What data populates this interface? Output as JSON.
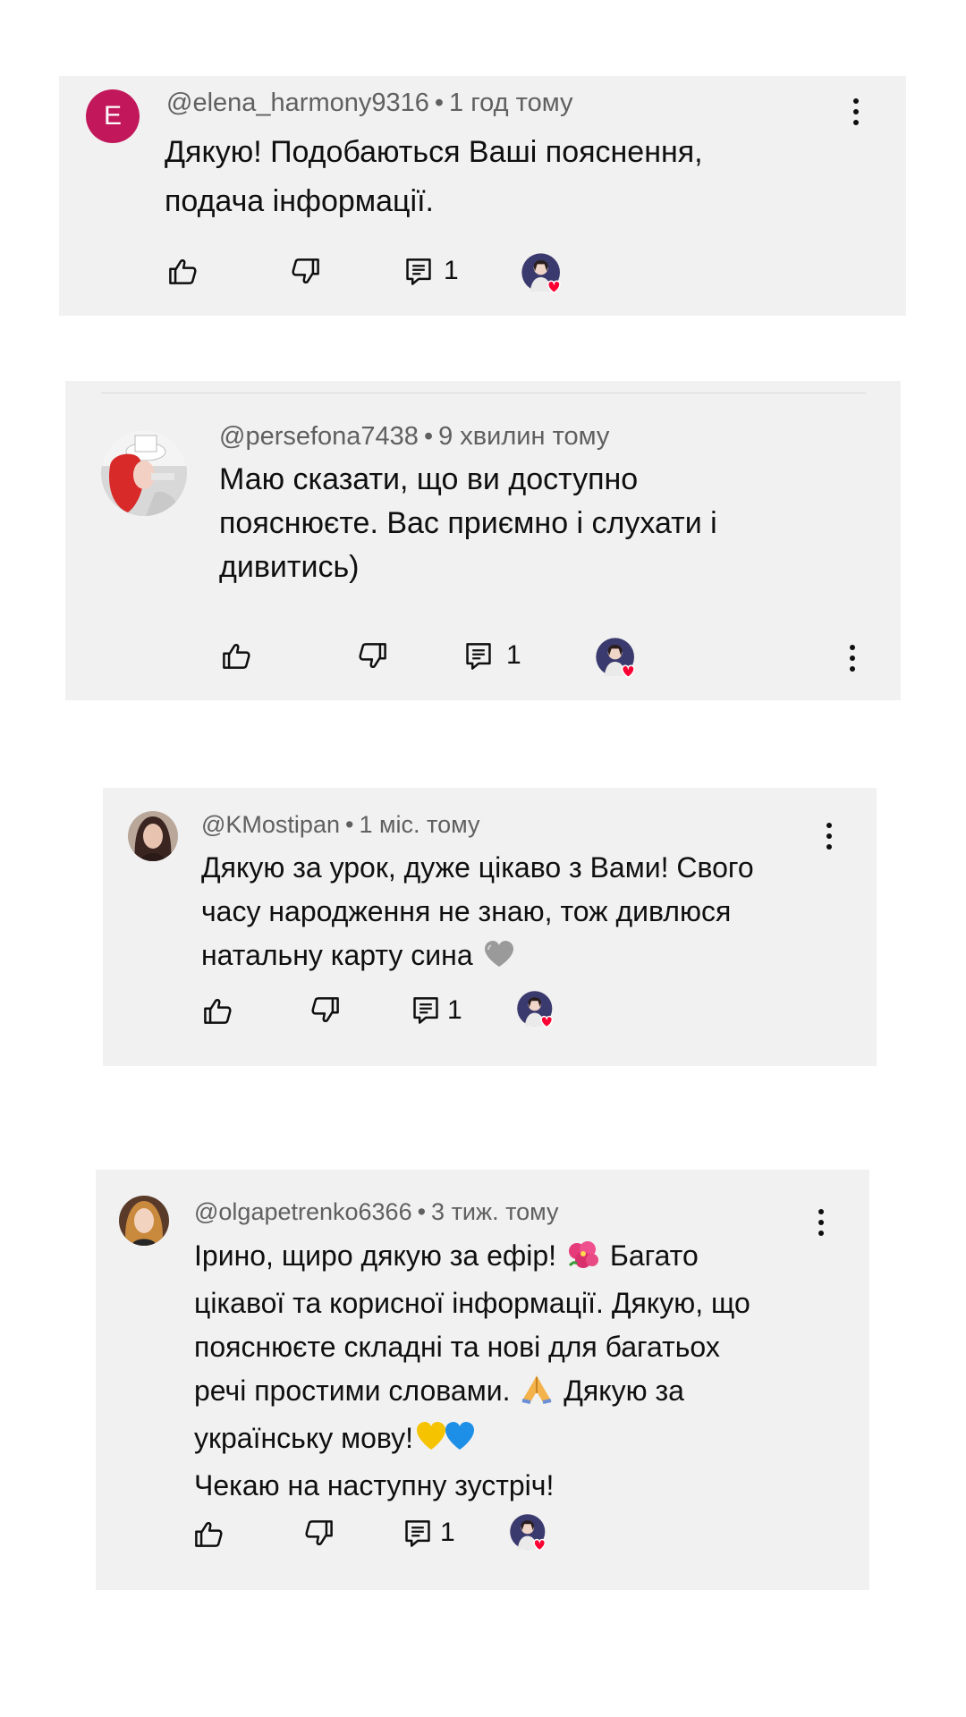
{
  "colors": {
    "card_bg": "#f1f1f1",
    "meta_text": "#606060",
    "body_text": "#0f0f0f",
    "heart": "#ff0033",
    "avatar_e": "#c2185b"
  },
  "comments": [
    {
      "author": "@elena_harmony9316",
      "separator": "•",
      "time": "1 год тому",
      "avatar_letter": "E",
      "lines": [
        "Дякую! Подобаються Ваші пояснення,",
        "подача інформації."
      ],
      "reply_count": "1",
      "icons": [
        "like-icon",
        "dislike-icon",
        "reply-icon",
        "creator-heart-icon",
        "more-vert-icon"
      ]
    },
    {
      "author": "@persefona7438",
      "separator": "•",
      "time": "9 хвилин тому",
      "lines": [
        "Маю сказати, що ви доступно",
        "пояснюєте. Вас приємно  і слухати і",
        "дивитись)"
      ],
      "reply_count": "1"
    },
    {
      "author": "@KMostipan",
      "separator": "•",
      "time": "1 міс. тому",
      "lines": [
        "Дякую за урок, дуже цікаво з Вами! Свого",
        "часу народження не знаю, тож дивлюся",
        "натальну карту сина"
      ],
      "reply_count": "1"
    },
    {
      "author": "@olgapetrenko6366",
      "separator": "•",
      "time": "3 тиж. тому",
      "line1": "Ірино, щиро дякую за ефір!",
      "line1_end": "Багато",
      "line2": "цікавої та корисної інформації. Дякую, що",
      "line3": "пояснюєте складні та нові для багатьох",
      "line4": "речі простими словами.",
      "line4_end": "Дякую за",
      "line5": "українську мову!",
      "line6": "Чекаю на наступну зустріч!",
      "reply_count": "1"
    }
  ]
}
